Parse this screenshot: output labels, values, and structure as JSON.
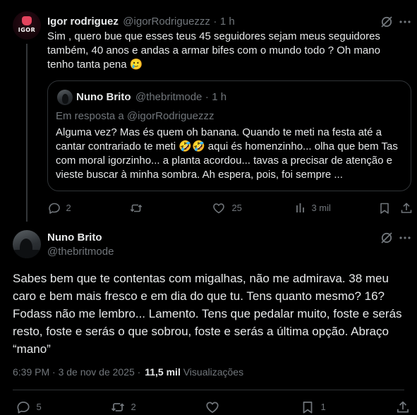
{
  "reply": {
    "author_name": "Igor rodriguez",
    "author_handle": "@igorRodriguezzz",
    "separator": "·",
    "time": "1 h",
    "avatar_text": "IGOR",
    "text": "Sim , quero bue que esses teus 45 seguidores sejam meus seguidores também, 40 anos e andas a armar bifes com o mundo todo ? Oh mano tenho tanta pena",
    "text_emoji": "🥲",
    "quote": {
      "author_name": "Nuno Brito",
      "author_handle": "@thebritmode",
      "time": "1 h",
      "reply_context": "Em resposta a @igorRodriguezzz",
      "text_1": "Alguma vez? Mas és quem oh banana. Quando te meti na festa até a cantar contrariado te meti",
      "text_emoji": "🤣🤣",
      "text_2": "aqui és homenzinho... olha que bem Tas com moral igorzinho... a planta acordou... tavas a precisar de atenção e vieste buscar à minha sombra. Ah espera, pois, foi sempre ..."
    },
    "actions": {
      "replies": "2",
      "reposts": "",
      "likes": "25",
      "views": "3 mil"
    }
  },
  "main": {
    "author_name": "Nuno Brito",
    "author_handle": "@thebritmode",
    "text": "Sabes bem que te contentas com migalhas, não me admirava. 38 meu caro e bem mais fresco e em dia do que tu. Tens quanto mesmo? 16? Fodass não me lembro... Lamento. Tens que pedalar muito, foste e serás resto, foste e serás o que sobrou, foste e serás a última opção. Abraço “mano”",
    "timestamp": "6:39 PM · 3 de nov de 2025 ·",
    "views_count": "11,5 mil",
    "views_label": "Visualizações",
    "actions": {
      "replies": "5",
      "reposts": "2",
      "likes": "",
      "bookmarks": "1"
    }
  },
  "colors": {
    "background": "#000000",
    "text": "#e7e9ea",
    "muted": "#71767b",
    "border": "#2f3336",
    "avatar_accent": "#e3445e"
  },
  "icons": [
    "grok-icon",
    "more-icon",
    "reply-icon",
    "repost-icon",
    "like-icon",
    "views-icon",
    "bookmark-icon",
    "share-icon"
  ]
}
